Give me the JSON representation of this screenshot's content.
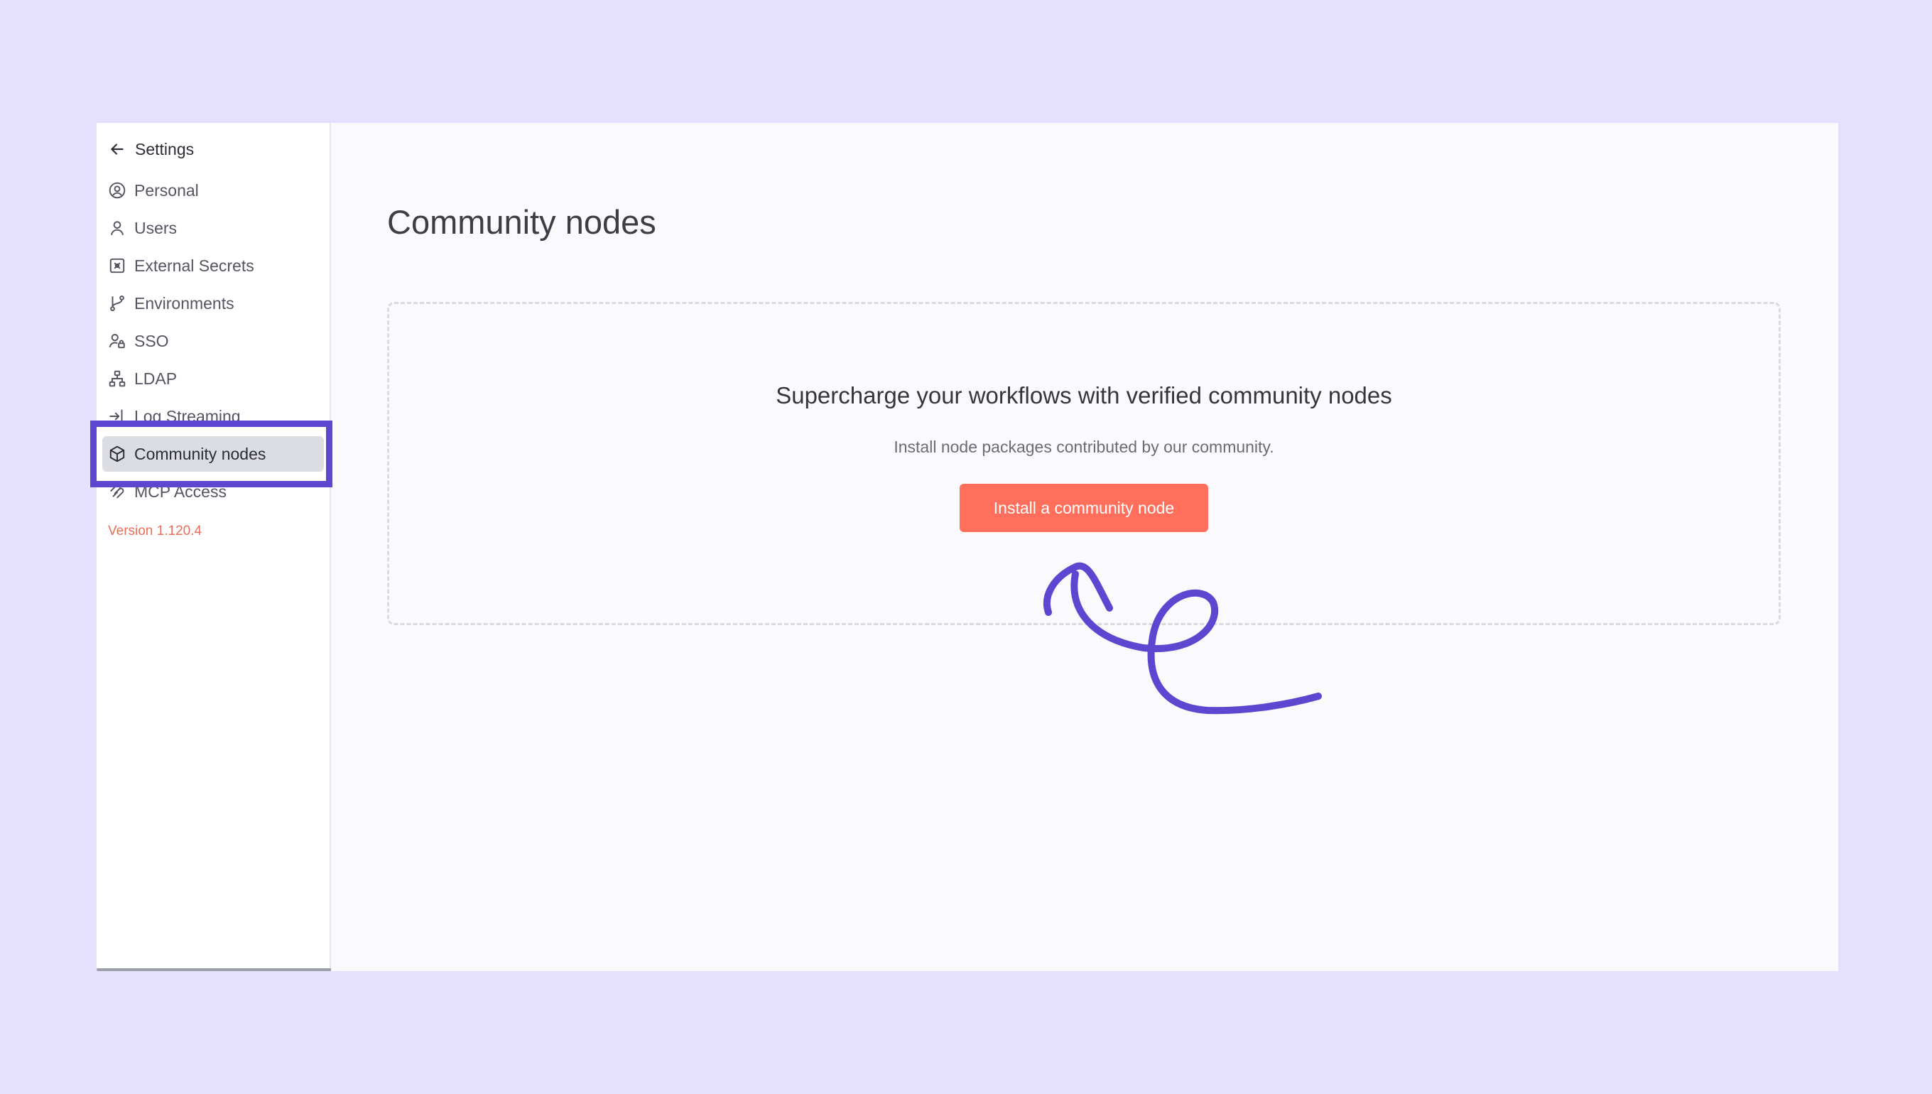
{
  "sidebar": {
    "back_label": "Settings",
    "items": [
      {
        "label": "Personal",
        "icon": "user-circle-icon"
      },
      {
        "label": "Users",
        "icon": "user-icon"
      },
      {
        "label": "External Secrets",
        "icon": "vault-icon"
      },
      {
        "label": "Environments",
        "icon": "git-branch-icon"
      },
      {
        "label": "SSO",
        "icon": "user-lock-icon"
      },
      {
        "label": "LDAP",
        "icon": "network-icon"
      },
      {
        "label": "Log Streaming",
        "icon": "sign-in-icon"
      },
      {
        "label": "Community nodes",
        "icon": "cube-icon",
        "active": true
      },
      {
        "label": "MCP Access",
        "icon": "mcp-icon"
      }
    ],
    "version": "Version 1.120.4"
  },
  "main": {
    "title": "Community nodes",
    "empty_state": {
      "heading": "Supercharge your workflows with verified community nodes",
      "description": "Install node packages contributed by our community.",
      "button_label": "Install a community node"
    }
  },
  "colors": {
    "background": "#e5e0fe",
    "accent": "#ff6f5c",
    "annotation": "#5d46d0",
    "version": "#ea6f5a"
  }
}
